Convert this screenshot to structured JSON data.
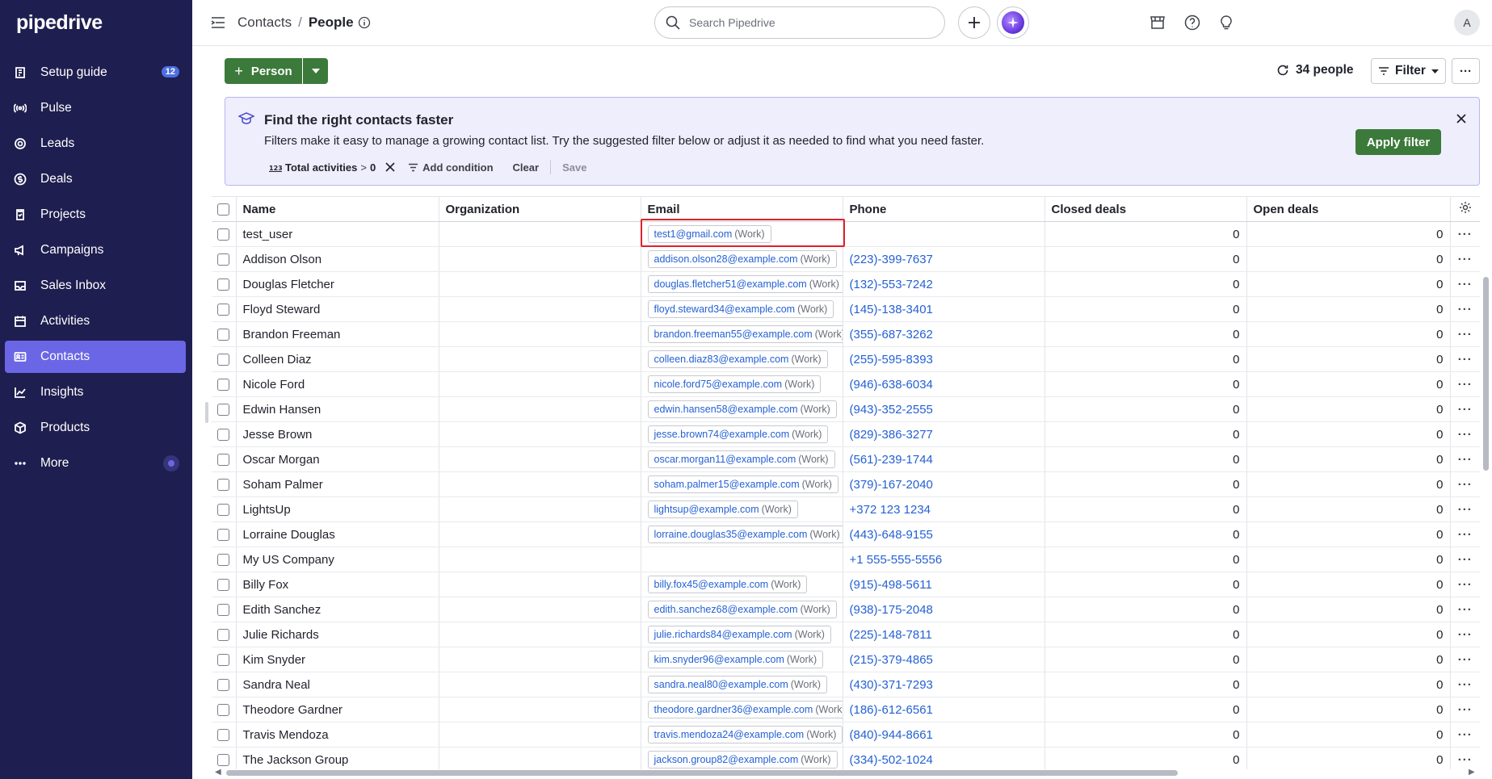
{
  "sidebar": {
    "logo": "pipedrive",
    "items": [
      {
        "label": "Setup guide",
        "icon": "setup-guide-icon",
        "badge": "12"
      },
      {
        "label": "Pulse",
        "icon": "pulse-icon"
      },
      {
        "label": "Leads",
        "icon": "leads-icon"
      },
      {
        "label": "Deals",
        "icon": "deals-icon"
      },
      {
        "label": "Projects",
        "icon": "projects-icon"
      },
      {
        "label": "Campaigns",
        "icon": "campaigns-icon"
      },
      {
        "label": "Sales Inbox",
        "icon": "mail-icon"
      },
      {
        "label": "Activities",
        "icon": "calendar-icon"
      },
      {
        "label": "Contacts",
        "icon": "contacts-icon",
        "active": true
      },
      {
        "label": "Insights",
        "icon": "insights-icon"
      },
      {
        "label": "Products",
        "icon": "products-icon"
      },
      {
        "label": "More",
        "icon": "more-icon"
      }
    ]
  },
  "header": {
    "breadcrumb_parent": "Contacts",
    "breadcrumb_sep": "/",
    "breadcrumb_current": "People",
    "search_placeholder": "Search Pipedrive",
    "avatar_initial": "A"
  },
  "actions": {
    "person_label": "Person",
    "people_count": "34 people",
    "filter_label": "Filter",
    "more_label": "···"
  },
  "banner": {
    "title": "Find the right contacts faster",
    "text": "Filters make it easy to manage a growing contact list. Try the suggested filter below or adjust it as needed to find what you need faster.",
    "apply_label": "Apply filter",
    "condition_field": "Total activities",
    "condition_op": ">",
    "condition_value": "0",
    "add_condition_label": "Add condition",
    "clear_label": "Clear",
    "save_label": "Save"
  },
  "table": {
    "columns": [
      "Name",
      "Organization",
      "Email",
      "Phone",
      "Closed deals",
      "Open deals"
    ],
    "email_tag": "(Work)",
    "rows": [
      {
        "name": "test_user",
        "org": "",
        "email": "test1@gmail.com",
        "phone": "",
        "closed": "0",
        "open": "0"
      },
      {
        "name": "Addison Olson",
        "org": "",
        "email": "addison.olson28@example.com",
        "phone": "(223)-399-7637",
        "closed": "0",
        "open": "0"
      },
      {
        "name": "Douglas Fletcher",
        "org": "",
        "email": "douglas.fletcher51@example.com",
        "phone": "(132)-553-7242",
        "closed": "0",
        "open": "0"
      },
      {
        "name": "Floyd Steward",
        "org": "",
        "email": "floyd.steward34@example.com",
        "phone": "(145)-138-3401",
        "closed": "0",
        "open": "0"
      },
      {
        "name": "Brandon Freeman",
        "org": "",
        "email": "brandon.freeman55@example.com",
        "phone": "(355)-687-3262",
        "closed": "0",
        "open": "0"
      },
      {
        "name": "Colleen Diaz",
        "org": "",
        "email": "colleen.diaz83@example.com",
        "phone": "(255)-595-8393",
        "closed": "0",
        "open": "0"
      },
      {
        "name": "Nicole Ford",
        "org": "",
        "email": "nicole.ford75@example.com",
        "phone": "(946)-638-6034",
        "closed": "0",
        "open": "0"
      },
      {
        "name": "Edwin Hansen",
        "org": "",
        "email": "edwin.hansen58@example.com",
        "phone": "(943)-352-2555",
        "closed": "0",
        "open": "0"
      },
      {
        "name": "Jesse Brown",
        "org": "",
        "email": "jesse.brown74@example.com",
        "phone": "(829)-386-3277",
        "closed": "0",
        "open": "0"
      },
      {
        "name": "Oscar Morgan",
        "org": "",
        "email": "oscar.morgan11@example.com",
        "phone": "(561)-239-1744",
        "closed": "0",
        "open": "0"
      },
      {
        "name": "Soham Palmer",
        "org": "",
        "email": "soham.palmer15@example.com",
        "phone": "(379)-167-2040",
        "closed": "0",
        "open": "0"
      },
      {
        "name": "LightsUp",
        "org": "",
        "email": "lightsup@example.com",
        "phone": "+372 123 1234",
        "closed": "0",
        "open": "0"
      },
      {
        "name": "Lorraine Douglas",
        "org": "",
        "email": "lorraine.douglas35@example.com",
        "phone": "(443)-648-9155",
        "closed": "0",
        "open": "0"
      },
      {
        "name": "My US Company",
        "org": "",
        "email": "",
        "phone": "+1 555-555-5556",
        "closed": "0",
        "open": "0"
      },
      {
        "name": "Billy Fox",
        "org": "",
        "email": "billy.fox45@example.com",
        "phone": "(915)-498-5611",
        "closed": "0",
        "open": "0"
      },
      {
        "name": "Edith Sanchez",
        "org": "",
        "email": "edith.sanchez68@example.com",
        "phone": "(938)-175-2048",
        "closed": "0",
        "open": "0"
      },
      {
        "name": "Julie Richards",
        "org": "",
        "email": "julie.richards84@example.com",
        "phone": "(225)-148-7811",
        "closed": "0",
        "open": "0"
      },
      {
        "name": "Kim Snyder",
        "org": "",
        "email": "kim.snyder96@example.com",
        "phone": "(215)-379-4865",
        "closed": "0",
        "open": "0"
      },
      {
        "name": "Sandra Neal",
        "org": "",
        "email": "sandra.neal80@example.com",
        "phone": "(430)-371-7293",
        "closed": "0",
        "open": "0"
      },
      {
        "name": "Theodore Gardner",
        "org": "",
        "email": "theodore.gardner36@example.com",
        "phone": "(186)-612-6561",
        "closed": "0",
        "open": "0"
      },
      {
        "name": "Travis Mendoza",
        "org": "",
        "email": "travis.mendoza24@example.com",
        "phone": "(840)-944-8661",
        "closed": "0",
        "open": "0"
      },
      {
        "name": "The Jackson Group",
        "org": "",
        "email": "jackson.group82@example.com",
        "phone": "(334)-502-1024",
        "closed": "0",
        "open": "0"
      }
    ]
  },
  "colors": {
    "sidebar_bg": "#1f1e50",
    "active_nav": "#6a66e6",
    "primary_green": "#3b7a3a",
    "link_blue": "#2461d4",
    "highlight_red": "#e0202a"
  }
}
